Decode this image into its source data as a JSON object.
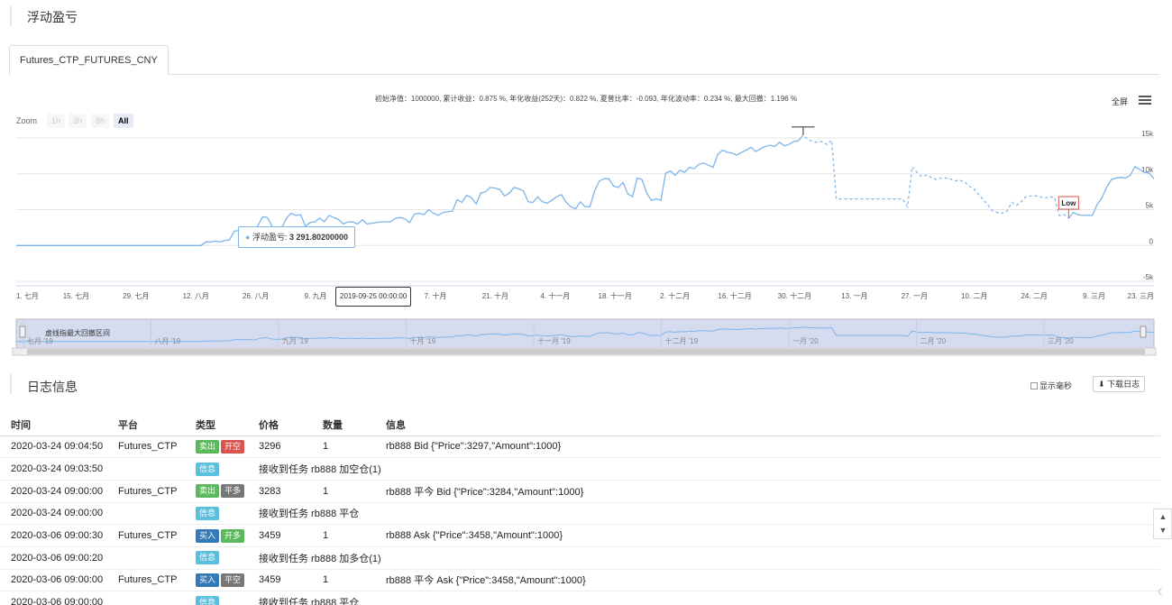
{
  "panel_title": "浮动盈亏",
  "tab": "Futures_CTP_FUTURES_CNY",
  "summary": "初始净值：1000000, 累计收益：0.875 %, 年化收益(252天)：0.822 %, 夏普比率：-0.093, 年化波动率：0.234 %, 最大回撤：1.196 %",
  "fullscreen": "全屏",
  "zoom": {
    "label": "Zoom",
    "buttons": [
      "1h",
      "3h",
      "8h",
      "All"
    ],
    "active": "All"
  },
  "chart_data": {
    "type": "line",
    "series": [
      {
        "name": "浮动盈亏"
      }
    ],
    "y_ticks": [
      "15k",
      "10k",
      "5k",
      "0",
      "-5k"
    ],
    "ylim": [
      -5000,
      15000
    ],
    "x_ticks": [
      "1. 七月",
      "15. 七月",
      "29. 七月",
      "12. 八月",
      "26. 八月",
      "9. 九月",
      "23. 九月",
      "7. 十月",
      "21. 十月",
      "4. 十一月",
      "18. 十一月",
      "2. 十二月",
      "16. 十二月",
      "30. 十二月",
      "13. 一月",
      "27. 一月",
      "10. 二月",
      "24. 二月",
      "9. 三月",
      "23. 三月"
    ],
    "values": [
      0,
      0,
      0,
      0,
      0,
      0,
      0,
      0,
      0,
      0,
      0,
      0,
      0,
      0,
      0,
      0,
      0,
      0,
      0,
      0,
      0,
      0,
      0,
      0,
      0,
      0,
      0,
      0,
      0,
      0,
      0,
      0,
      0,
      0,
      0,
      0,
      0,
      0,
      0,
      0,
      500,
      500,
      600,
      500,
      700,
      800,
      2000,
      2100,
      2000,
      2200,
      1500,
      2800,
      4000,
      3900,
      2600,
      2300,
      2500,
      3800,
      4500,
      4200,
      4300,
      2700,
      3200,
      3300,
      3800,
      3300,
      4200,
      3900,
      3600,
      3000,
      3291.8,
      3300,
      3000,
      3600,
      3000,
      3100,
      3200,
      3300,
      3300,
      3300,
      3800,
      3900,
      3700,
      3200,
      4400,
      4500,
      4300,
      5000,
      4500,
      4200,
      4600,
      4700,
      4800,
      6400,
      6000,
      7000,
      6700,
      5800,
      7300,
      7500,
      8100,
      8000,
      7800,
      6900,
      7300,
      8100,
      7900,
      7600,
      6100,
      6000,
      6800,
      6100,
      5900,
      6300,
      6800,
      7100,
      6000,
      5400,
      5100,
      6100,
      5400,
      5400,
      7600,
      9000,
      9300,
      9300,
      8300,
      8100,
      8800,
      7200,
      6800,
      9400,
      9200,
      7300,
      6300,
      6500,
      6300,
      10100,
      10400,
      9800,
      10500,
      10200,
      10900,
      10700,
      11300,
      11500,
      11200,
      10900,
      12700,
      13300,
      13000,
      12900,
      12600,
      13000,
      13300,
      13700,
      13100,
      13500,
      13800,
      14000,
      13800,
      14400,
      13900,
      14100,
      14500,
      14600,
      15400,
      14800,
      14500,
      14400,
      14500,
      14100,
      14700,
      6500,
      6500,
      6500,
      6500,
      6500,
      6500,
      6500,
      6500,
      6500,
      6500,
      6500,
      6500,
      6500,
      6500,
      6500,
      5400,
      11000,
      10200,
      9600,
      9800,
      9500,
      9200,
      9400,
      9400,
      9300,
      9000,
      9100,
      8900,
      8300,
      7900,
      7100,
      6400,
      5600,
      4800,
      4600,
      4500,
      4800,
      6000,
      5600,
      6100,
      6800,
      6900,
      6900,
      6800,
      6600,
      6800,
      6700,
      4200,
      4300,
      3800,
      4600,
      4300,
      4200,
      4200,
      4200,
      5700,
      6600,
      8100,
      9200,
      9400,
      9500,
      9400,
      9800,
      11000,
      10600,
      10200,
      10100,
      9300
    ],
    "labels": {
      "high": "High",
      "low": "Low"
    }
  },
  "tooltip": {
    "series": "浮动盈亏:",
    "value": "3 291.80200000",
    "x": "2019-09-25 00:00:00"
  },
  "navigator": {
    "label": "虚线指最大回撤区间",
    "ticks": [
      "七月 '19",
      "八月 '19",
      "九月 '19",
      "十月 '19",
      "十一月 '19",
      "十二月 '19",
      "一月 '20",
      "二月 '20",
      "三月 '20"
    ]
  },
  "log": {
    "title": "日志信息",
    "show_ms": "显示毫秒",
    "download": "下载日志",
    "columns": [
      "时间",
      "平台",
      "类型",
      "价格",
      "数量",
      "信息"
    ],
    "rows": [
      {
        "time": "2020-03-24 09:04:50",
        "platform": "Futures_CTP",
        "badges": [
          {
            "text": "卖出",
            "kind": "sell"
          },
          {
            "text": "开空",
            "kind": "open-short"
          }
        ],
        "price": "3296",
        "qty": "1",
        "info": "rb888 Bid {\"Price\":3297,\"Amount\":1000}"
      },
      {
        "time": "2020-03-24 09:03:50",
        "platform": "",
        "badges": [
          {
            "text": "信息",
            "kind": "info"
          }
        ],
        "price": "",
        "qty": "",
        "info": "接收到任务 rb888 加空仓(1)"
      },
      {
        "time": "2020-03-24 09:00:00",
        "platform": "Futures_CTP",
        "badges": [
          {
            "text": "卖出",
            "kind": "sell"
          },
          {
            "text": "平多",
            "kind": "close"
          }
        ],
        "price": "3283",
        "qty": "1",
        "info": "rb888 平今 Bid {\"Price\":3284,\"Amount\":1000}"
      },
      {
        "time": "2020-03-24 09:00:00",
        "platform": "",
        "badges": [
          {
            "text": "信息",
            "kind": "info"
          }
        ],
        "price": "",
        "qty": "",
        "info": "接收到任务 rb888 平仓"
      },
      {
        "time": "2020-03-06 09:00:30",
        "platform": "Futures_CTP",
        "badges": [
          {
            "text": "买入",
            "kind": "buy"
          },
          {
            "text": "开多",
            "kind": "open-long"
          }
        ],
        "price": "3459",
        "qty": "1",
        "info": "rb888 Ask {\"Price\":3458,\"Amount\":1000}"
      },
      {
        "time": "2020-03-06 09:00:20",
        "platform": "",
        "badges": [
          {
            "text": "信息",
            "kind": "info"
          }
        ],
        "price": "",
        "qty": "",
        "info": "接收到任务 rb888 加多仓(1)"
      },
      {
        "time": "2020-03-06 09:00:00",
        "platform": "Futures_CTP",
        "badges": [
          {
            "text": "买入",
            "kind": "buy"
          },
          {
            "text": "平空",
            "kind": "close"
          }
        ],
        "price": "3459",
        "qty": "1",
        "info": "rb888 平今 Ask {\"Price\":3458,\"Amount\":1000}"
      },
      {
        "time": "2020-03-06 09:00:00",
        "platform": "",
        "badges": [
          {
            "text": "信息",
            "kind": "info"
          }
        ],
        "price": "",
        "qty": "",
        "info": "接收到任务 rb888 平仓"
      }
    ]
  },
  "colors": {
    "line": "#7cb5ec",
    "navigator_fill": "#d6dcf0"
  }
}
